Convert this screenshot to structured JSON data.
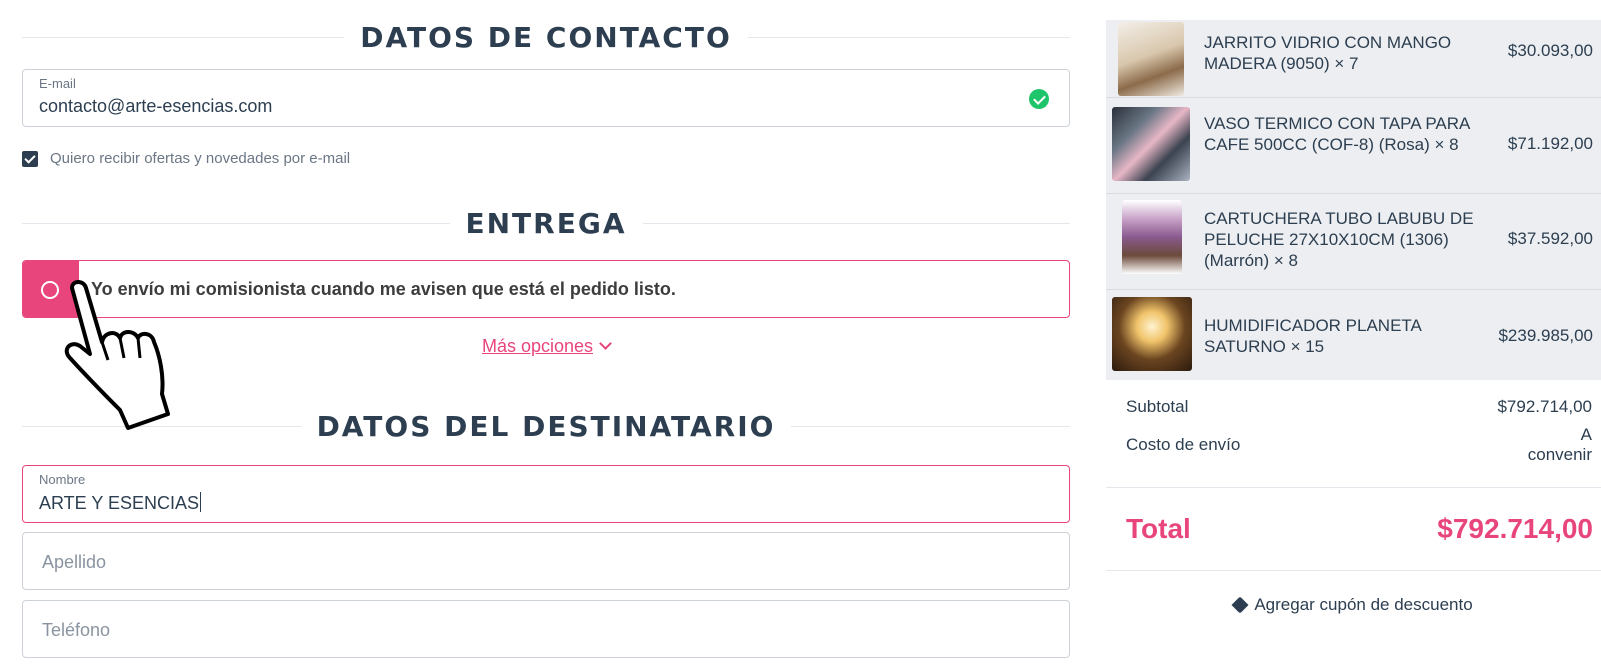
{
  "contact": {
    "title": "DATOS DE CONTACTO",
    "email_label": "E-mail",
    "email_value": "contacto@arte-esencias.com",
    "newsletter_label": "Quiero recibir ofertas y novedades por e-mail",
    "newsletter_checked": true
  },
  "delivery": {
    "title": "ENTREGA",
    "selected_option": "Yo envío mi comisionista cuando me avisen que está el pedido listo.",
    "more_options_label": "Más opciones"
  },
  "recipient": {
    "title": "DATOS DEL DESTINATARIO",
    "name_label": "Nombre",
    "name_value": "ARTE Y ESENCIAS",
    "lastname_placeholder": "Apellido",
    "phone_placeholder": "Teléfono"
  },
  "cart": {
    "items": [
      {
        "name": "JARRITO VIDRIO CON MANGO MADERA (9050) × 7",
        "price": "$30.093,00"
      },
      {
        "name": "VASO TERMICO CON TAPA PARA CAFE 500CC (COF-8) (Rosa) × 8",
        "price": "$71.192,00"
      },
      {
        "name": "CARTUCHERA TUBO LABUBU DE PELUCHE 27X10X10CM (1306) (Marrón) × 8",
        "price": "$37.592,00"
      },
      {
        "name": "HUMIDIFICADOR PLANETA SATURNO × 15",
        "price": "$239.985,00"
      }
    ],
    "subtotal_label": "Subtotal",
    "subtotal_value": "$792.714,00",
    "shipping_label": "Costo de envío",
    "shipping_value_line1": "A",
    "shipping_value_line2": "convenir",
    "total_label": "Total",
    "total_value": "$792.714,00",
    "coupon_label": "Agregar cupón de descuento"
  },
  "colors": {
    "accent": "#e8457c",
    "text": "#2c3e50",
    "success": "#1fc56a"
  },
  "icons": [
    "check-circle-icon",
    "checkbox-checked-icon",
    "radio-icon",
    "chevron-down-icon",
    "hand-pointer-icon",
    "tag-icon"
  ]
}
